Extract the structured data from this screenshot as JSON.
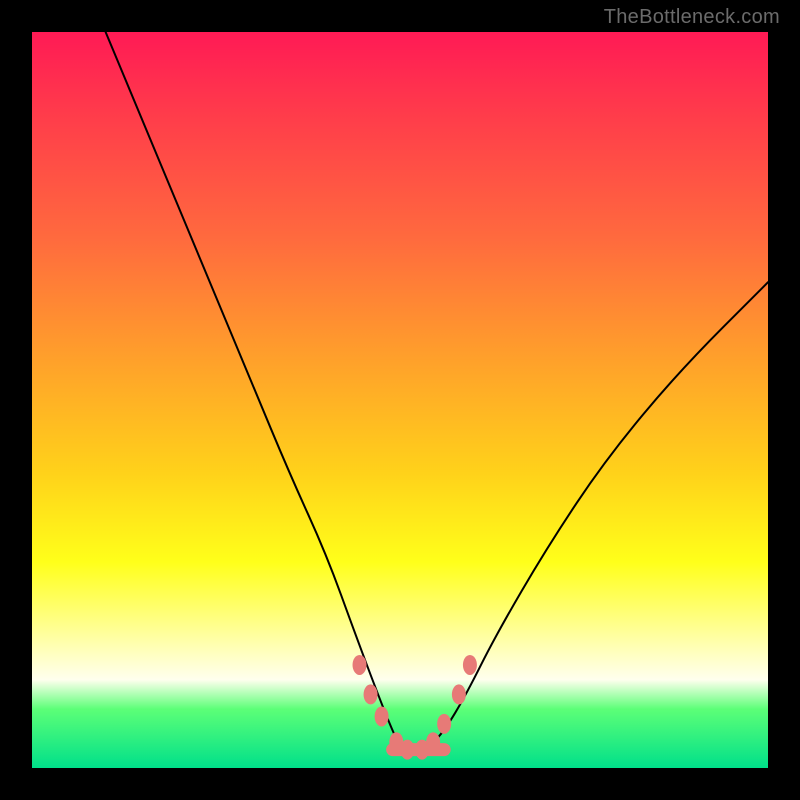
{
  "watermark": "TheBottleneck.com",
  "colors": {
    "frame": "#000000",
    "curve": "#000000",
    "marker": "#e77a77",
    "gradient_top": "#ff1a55",
    "gradient_bottom": "#00e08a"
  },
  "chart_data": {
    "type": "line",
    "title": "",
    "xlabel": "",
    "ylabel": "",
    "xlim": [
      0,
      100
    ],
    "ylim": [
      0,
      100
    ],
    "x": [
      10,
      15,
      20,
      25,
      30,
      35,
      40,
      44,
      47,
      49,
      50,
      51,
      52,
      53,
      54,
      56,
      59,
      63,
      70,
      78,
      88,
      100
    ],
    "y": [
      100,
      88,
      76,
      64,
      52,
      40,
      29,
      18,
      10,
      5,
      3,
      2,
      2,
      2,
      3,
      5,
      10,
      18,
      30,
      42,
      54,
      66
    ],
    "markers": {
      "x": [
        44.5,
        46,
        47.5,
        49.5,
        51,
        53,
        54.5,
        56,
        58,
        59.5
      ],
      "y": [
        14,
        10,
        7,
        3.5,
        2.5,
        2.5,
        3.5,
        6,
        10,
        14
      ]
    },
    "flat_segment": {
      "x0": 49,
      "x1": 56,
      "y": 2.5
    }
  }
}
